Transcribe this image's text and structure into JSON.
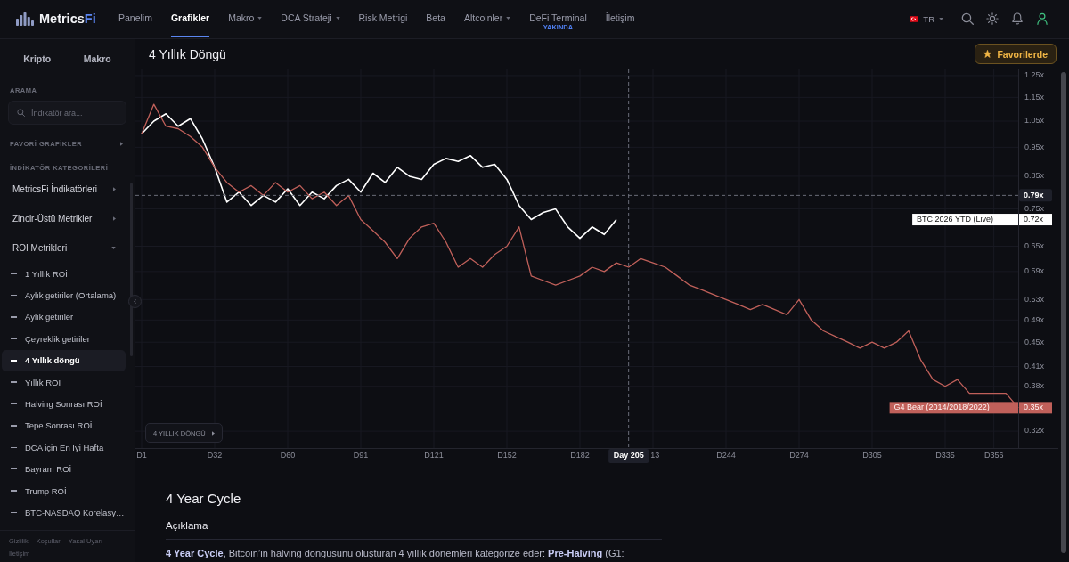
{
  "nav": {
    "logo": {
      "name": "Metrics",
      "accent": "Fi"
    },
    "items": [
      {
        "label": "Panelim",
        "selected": false,
        "dropdown": false
      },
      {
        "label": "Grafikler",
        "selected": true,
        "dropdown": false
      },
      {
        "label": "Makro",
        "selected": false,
        "dropdown": true
      },
      {
        "label": "DCA Strateji",
        "selected": false,
        "dropdown": true
      },
      {
        "label": "Risk Metrigi",
        "selected": false,
        "dropdown": false
      },
      {
        "label": "Beta",
        "selected": false,
        "dropdown": false
      },
      {
        "label": "Altcoinler",
        "selected": false,
        "dropdown": true
      },
      {
        "label": "DeFi Terminal",
        "selected": false,
        "dropdown": false,
        "badge": "YAKINDA"
      },
      {
        "label": "İletişim",
        "selected": false,
        "dropdown": false
      }
    ],
    "language": {
      "label": "TR"
    }
  },
  "sidebar": {
    "tabs": [
      {
        "label": "Kripto"
      },
      {
        "label": "Makro"
      }
    ],
    "search": {
      "heading": "ARAMA",
      "placeholder": "İndikatör ara..."
    },
    "favorites": {
      "heading": "FAVORİ GRAFİKLER",
      "expanded": false
    },
    "categories_heading": "İNDİKATÖR KATEGORİLERİ",
    "categories": [
      {
        "label": "MetricsFi İndikatörleri",
        "expanded": false
      },
      {
        "label": "Zincir-Üstü Metrikler",
        "expanded": false
      },
      {
        "label": "ROI Metrikleri",
        "expanded": true,
        "children": [
          {
            "label": "1 Yıllık ROİ",
            "selected": false
          },
          {
            "label": "Aylık getiriler (Ortalama)",
            "selected": false
          },
          {
            "label": "Aylık getiriler",
            "selected": false
          },
          {
            "label": "Çeyreklik getiriler",
            "selected": false
          },
          {
            "label": "4 Yıllık döngü",
            "selected": true
          },
          {
            "label": "Yıllık ROİ",
            "selected": false
          },
          {
            "label": "Halving Sonrası ROİ",
            "selected": false
          },
          {
            "label": "Tepe Sonrası ROİ",
            "selected": false
          },
          {
            "label": "DCA için En İyi Hafta",
            "selected": false
          },
          {
            "label": "Bayram ROİ",
            "selected": false
          },
          {
            "label": "Trump ROİ",
            "selected": false
          },
          {
            "label": "BTC-NASDAQ Korelasy…",
            "selected": false
          }
        ]
      }
    ],
    "footer_links": [
      "Gizlilik",
      "Koşullar",
      "Yasal Uyarı",
      "İletişim"
    ]
  },
  "header": {
    "title": "4 Yıllık Döngü",
    "favorite_button": {
      "label": "Favorilerde",
      "on": true
    }
  },
  "chart": {
    "chip": "4 YILLIK DÖNGÜ",
    "crosshair": {
      "x_label": "Day 205"
    },
    "end_labels": [
      "0.72x",
      "0.35x"
    ],
    "chart_data": {
      "type": "line",
      "categories": [
        "D1",
        null,
        null,
        null,
        null,
        null,
        "D32",
        null,
        null,
        null,
        null,
        null,
        "D60",
        null,
        null,
        null,
        null,
        null,
        "D91",
        null,
        null,
        null,
        null,
        null,
        "D121",
        null,
        null,
        null,
        null,
        null,
        "D152",
        null,
        null,
        null,
        null,
        null,
        "D182",
        null,
        null,
        null,
        null,
        null,
        "13",
        null,
        null,
        null,
        null,
        null,
        "D244",
        null,
        null,
        null,
        null,
        null,
        "D274",
        null,
        null,
        null,
        null,
        null,
        "D305",
        null,
        null,
        null,
        null,
        null,
        "D335",
        null,
        null,
        null,
        "D356",
        null,
        null
      ],
      "series": [
        {
          "name": "BTC 2026 YTD (Live)",
          "color": "#ffffff",
          "values": [
            1.0,
            1.05,
            1.08,
            1.03,
            1.06,
            0.98,
            0.88,
            0.77,
            0.8,
            0.76,
            0.79,
            0.77,
            0.81,
            0.76,
            0.8,
            0.78,
            0.82,
            0.84,
            0.8,
            0.86,
            0.83,
            0.88,
            0.85,
            0.84,
            0.89,
            0.91,
            0.9,
            0.92,
            0.88,
            0.89,
            0.84,
            0.76,
            0.72,
            0.74,
            0.75,
            0.7,
            0.67,
            0.7,
            0.68,
            0.72,
            null,
            null,
            null,
            null,
            null,
            null,
            null,
            null,
            null,
            null,
            null,
            null,
            null,
            null,
            null,
            null,
            null,
            null,
            null,
            null,
            null,
            null,
            null,
            null,
            null,
            null,
            null,
            null,
            null,
            null,
            null,
            null,
            null
          ]
        },
        {
          "name": "G4 Bear (2014/2018/2022)",
          "color": "#c0605a",
          "values": [
            1.0,
            1.12,
            1.03,
            1.02,
            0.99,
            0.95,
            0.88,
            0.83,
            0.8,
            0.82,
            0.79,
            0.83,
            0.8,
            0.82,
            0.78,
            0.8,
            0.76,
            0.79,
            0.72,
            0.69,
            0.66,
            0.62,
            0.67,
            0.7,
            0.71,
            0.66,
            0.6,
            0.62,
            0.6,
            0.63,
            0.65,
            0.7,
            0.58,
            0.57,
            0.56,
            0.57,
            0.58,
            0.6,
            0.59,
            0.61,
            0.6,
            0.62,
            0.61,
            0.6,
            0.58,
            0.56,
            0.55,
            0.54,
            0.53,
            0.52,
            0.51,
            0.52,
            0.51,
            0.5,
            0.53,
            0.49,
            0.47,
            0.46,
            0.45,
            0.44,
            0.45,
            0.44,
            0.45,
            0.47,
            0.42,
            0.39,
            0.38,
            0.39,
            0.37,
            0.37,
            0.37,
            0.37,
            0.35
          ]
        }
      ],
      "ylim": [
        0.3,
        1.28
      ],
      "log": true,
      "grid": true,
      "ref_lines": [
        {
          "axis": "y",
          "value": 0.79,
          "label": "0.79x"
        }
      ],
      "yticks": [
        {
          "value": 1.25,
          "label": "1.25x"
        },
        {
          "value": 1.15,
          "label": "1.15x"
        },
        {
          "value": 1.05,
          "label": "1.05x"
        },
        {
          "value": 0.95,
          "label": "0.95x"
        },
        {
          "value": 0.85,
          "label": "0.85x"
        },
        {
          "value": 0.75,
          "label": "0.75x"
        },
        {
          "value": 0.65,
          "label": "0.65x"
        },
        {
          "value": 0.59,
          "label": "0.59x"
        },
        {
          "value": 0.53,
          "label": "0.53x"
        },
        {
          "value": 0.49,
          "label": "0.49x"
        },
        {
          "value": 0.45,
          "label": "0.45x"
        },
        {
          "value": 0.41,
          "label": "0.41x"
        },
        {
          "value": 0.38,
          "label": "0.38x"
        },
        {
          "value": 0.32,
          "label": "0.32x"
        }
      ]
    }
  },
  "description": {
    "title": "4 Year Cycle",
    "subtitle": "Açıklama",
    "text": "**4 Year Cycle**, Bitcoin’in halving döngüsünü oluşturan 4 yıllık dönemleri kategorize eder: **Pre-Halving** (G1:"
  }
}
